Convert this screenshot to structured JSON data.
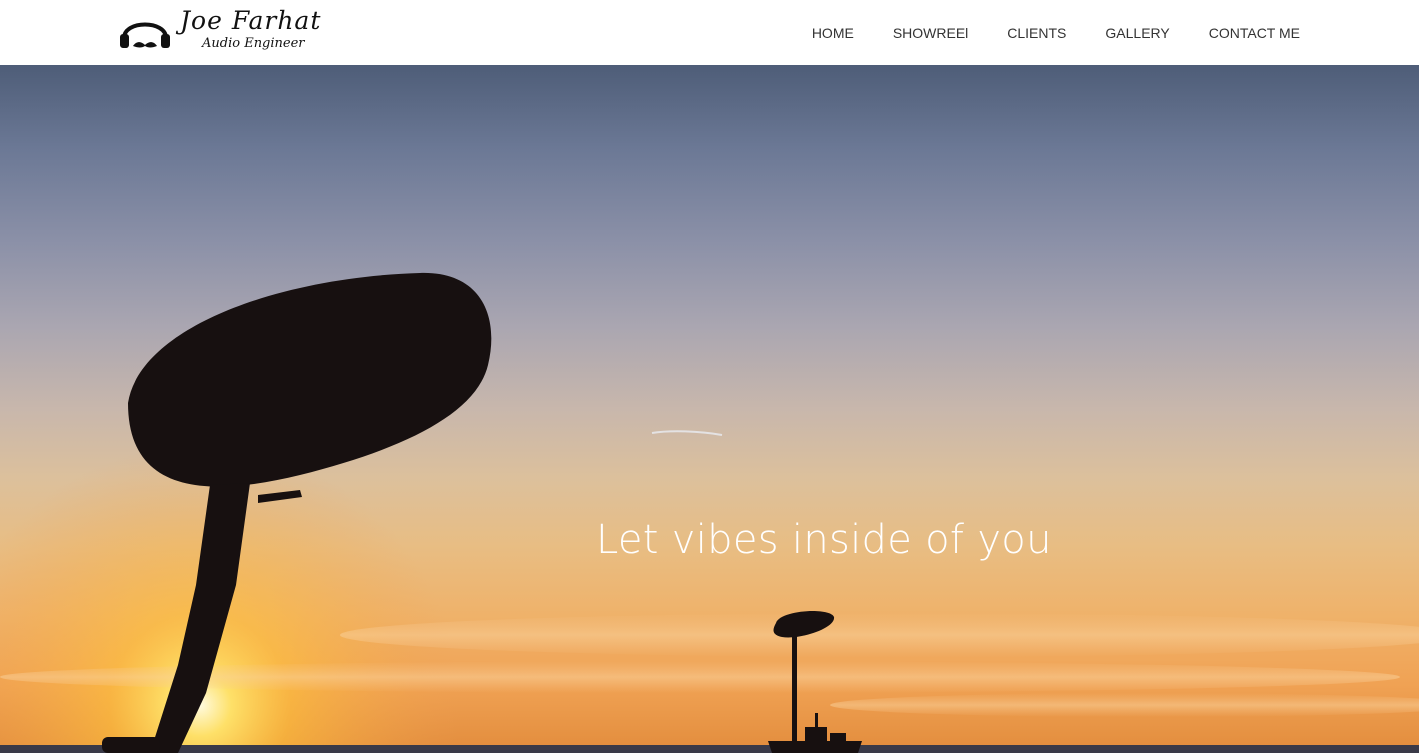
{
  "brand": {
    "name": "Joe Farhat",
    "subtitle": "Audio Engineer",
    "icon": "headphones-mustache-icon"
  },
  "nav": {
    "items": [
      {
        "label": "HOME"
      },
      {
        "label": "SHOWREEl"
      },
      {
        "label": "CLIENTS"
      },
      {
        "label": "GALLERY"
      },
      {
        "label": "CONTACT ME"
      }
    ]
  },
  "hero": {
    "tagline": "Let vibes inside of you"
  },
  "colors": {
    "header_bg": "#ffffff",
    "nav_text": "#333333",
    "sky_top": "#4e5d78",
    "sky_horizon": "#e28c3c",
    "tagline": "#ffffff"
  }
}
